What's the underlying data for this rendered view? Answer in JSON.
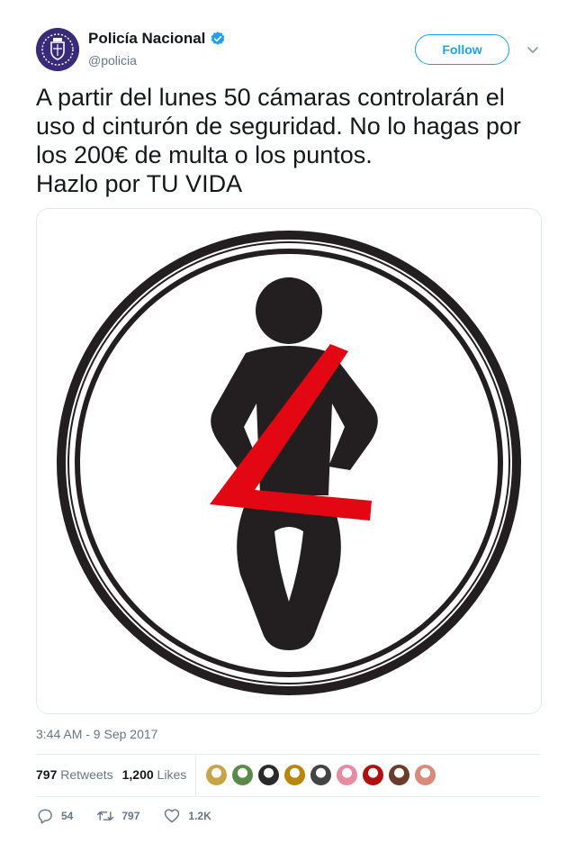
{
  "account": {
    "name": "Policía Nacional",
    "handle": "@policia",
    "verified": true
  },
  "header": {
    "follow_label": "Follow"
  },
  "tweet": {
    "lines": [
      "A partir del lunes 50 cámaras controlarán el",
      "uso d cinturón de seguridad. No lo hagas por",
      "los 200€ de multa o los puntos.",
      "Hazlo por TU VIDA"
    ],
    "timestamp": "3:44 AM - 9 Sep 2017"
  },
  "media": {
    "description_icon": "seatbelt-icon"
  },
  "stats": {
    "retweets_count": "797",
    "retweets_label": "Retweets",
    "likes_count": "1,200",
    "likes_label": "Likes"
  },
  "likers": [
    {
      "icon": "liker-avatar",
      "color": "#c9a34a"
    },
    {
      "icon": "liker-avatar",
      "color": "#5a8a4a"
    },
    {
      "icon": "liker-avatar",
      "color": "#2a2a2a"
    },
    {
      "icon": "liker-avatar",
      "color": "#b8860b"
    },
    {
      "icon": "liker-avatar",
      "color": "#444444"
    },
    {
      "icon": "liker-avatar",
      "color": "#e88aa0"
    },
    {
      "icon": "liker-avatar",
      "color": "#b01010"
    },
    {
      "icon": "liker-avatar",
      "color": "#6b3b2b"
    },
    {
      "icon": "liker-avatar",
      "color": "#d98a7a"
    }
  ],
  "actions": {
    "reply_count": "54",
    "retweet_count": "797",
    "like_count": "1.2K"
  },
  "colors": {
    "accent": "#1da1f2",
    "text": "#14171a",
    "muted": "#657786",
    "belt_red": "#e30613",
    "figure_dark": "#231f20"
  }
}
